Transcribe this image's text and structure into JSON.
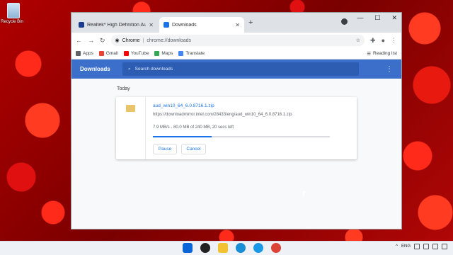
{
  "desktop": {
    "recycle_bin_label": "Recycle Bin"
  },
  "browser": {
    "tabs": [
      {
        "title": "Realtek* High Definition Audio D",
        "favicon_color": "#1a3c8f"
      },
      {
        "title": "Downloads",
        "favicon_color": "#1a73e8"
      }
    ],
    "new_tab_symbol": "+",
    "omnibox": {
      "site_label": "Chrome",
      "url": "chrome://downloads"
    },
    "bookmarks": [
      {
        "label": "Apps",
        "icon_color": "#5f6368"
      },
      {
        "label": "Gmail",
        "icon_color": "#ea4335"
      },
      {
        "label": "YouTube",
        "icon_color": "#ff0000"
      },
      {
        "label": "Maps",
        "icon_color": "#34a853"
      },
      {
        "label": "Translate",
        "icon_color": "#4285f4"
      }
    ],
    "reading_list": "Reading list"
  },
  "downloads_page": {
    "title": "Downloads",
    "search_placeholder": "Search downloads",
    "section_label": "Today",
    "item": {
      "file_name": "aud_win10_64_6.0.8716.1.zip",
      "url": "https://downloadmirror.intel.com/28433/eng/aud_win10_64_6.0.8716.1.zip",
      "status": "7.9 MB/s - 80.0 MB of 240 MB, 20 secs left",
      "progress_fraction": 0.33,
      "pause_label": "Pause",
      "cancel_label": "Cancel"
    }
  },
  "taskbar": {
    "icons": [
      {
        "name": "start",
        "color": "#0a66d6"
      },
      {
        "name": "search",
        "color": "#222222"
      },
      {
        "name": "file-explorer",
        "color": "#f2c230"
      },
      {
        "name": "edge",
        "color": "#1a8fd6"
      },
      {
        "name": "skype",
        "color": "#1a9ae6"
      },
      {
        "name": "chrome",
        "color": "#db4437"
      }
    ],
    "language": "ENG"
  },
  "colors": {
    "accent": "#3b6fc9",
    "link": "#1a73e8"
  }
}
